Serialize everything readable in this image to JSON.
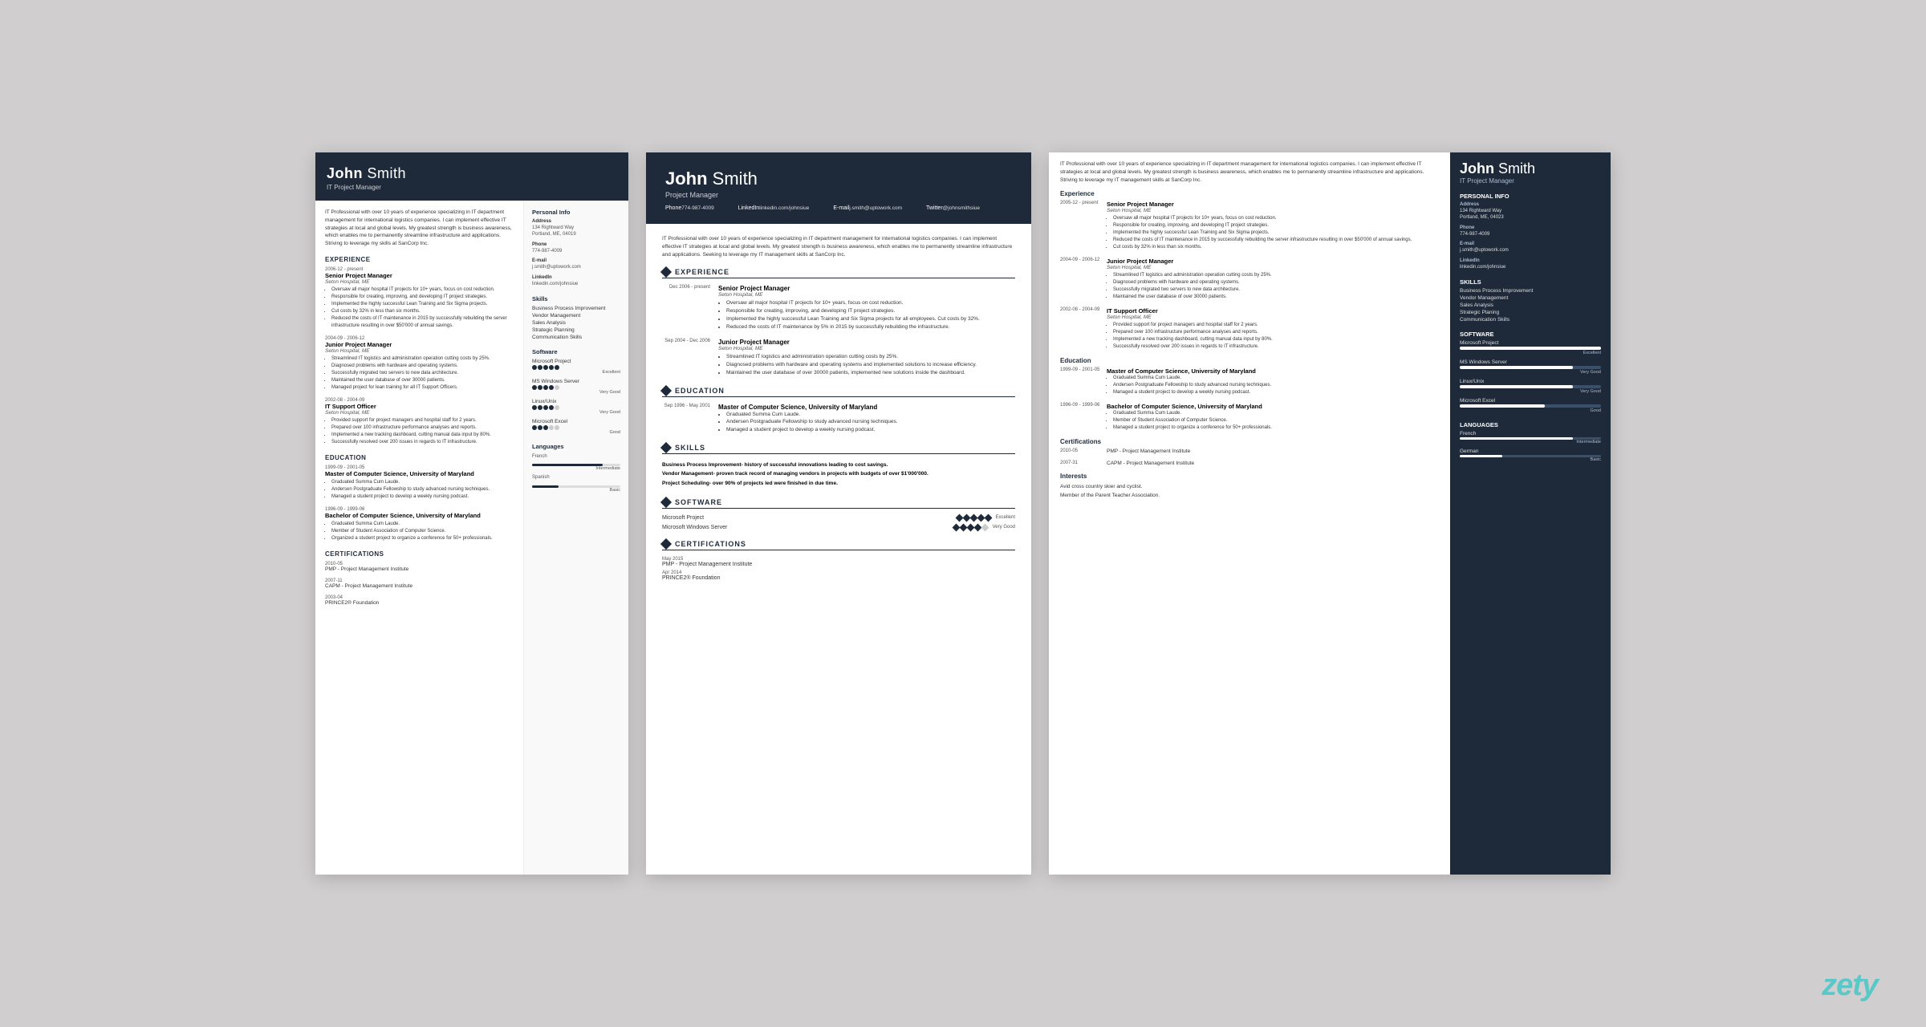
{
  "resume1": {
    "name_bold": "John",
    "name_light": " Smith",
    "title": "IT Project Manager",
    "summary": "IT Professional with over 10 years of experience specializing in IT department management for international logistics companies. I can implement effective IT strategies at local and global levels. My greatest strength is business awareness, which enables me to permanently streamline infrastructure and applications. Striving to leverage my skills at SanCorp Inc.",
    "experience_title": "Experience",
    "experience": [
      {
        "dates": "2006-12 - present",
        "title": "Senior Project Manager",
        "company": "Seton Hospital, ME",
        "bullets": [
          "Oversaw all major hospital IT projects for 10+ years, focus on cost reduction.",
          "Responsible for creating, improving, and developing IT project strategies.",
          "Implemented the highly successful Lean Training and Six Sigma projects.",
          "Cut costs by 32% in less than six months.",
          "Reduced the costs of IT maintenance in 2015 by successfully rebuilding the server infrastructure resulting in over $50'000 of annual savings."
        ]
      },
      {
        "dates": "2004-09 - 2006-12",
        "title": "Junior Project Manager",
        "company": "Seton Hospital, ME",
        "bullets": [
          "Streamlined IT logistics and administration operation cutting costs by 25%.",
          "Diagnosed problems with hardware and operating systems.",
          "Successfully migrated two servers to new data architecture.",
          "Maintained the user database of over 30000 patients.",
          "Managed project for lean training for all IT Support Officers."
        ]
      },
      {
        "dates": "2002-08 - 2004-09",
        "title": "IT Support Officer",
        "company": "Seton Hospital, ME",
        "bullets": [
          "Provided support for project managers and hospital staff for 2 years.",
          "Prepared over 100 infrastructure performance analyses and reports.",
          "Implemented a new tracking dashboard, cutting manual data input by 80%.",
          "Successfully resolved over 200 issues in regards to IT infrastructure."
        ]
      }
    ],
    "education_title": "Education",
    "education": [
      {
        "dates": "1999-09 - 2001-05",
        "title": "Master of Computer Science, University of Maryland",
        "bullets": [
          "Graduated Summa Cum Laude.",
          "Andersen Postgraduate Fellowship to study advanced nursing techniques.",
          "Managed a student project to develop a weekly nursing podcast."
        ]
      },
      {
        "dates": "1996-09 - 1999-06",
        "title": "Bachelor of Computer Science, University of Maryland",
        "bullets": [
          "Graduated Summa Cum Laude.",
          "Member of Student Association of Computer Science.",
          "Organized a student project to organize a conference for 50+ professionals."
        ]
      }
    ],
    "certifications_title": "Certifications",
    "certifications": [
      {
        "dates": "2010-05",
        "name": "PMP - Project Management Institute"
      },
      {
        "dates": "2007-11",
        "name": "CAPM - Project Management Institute"
      },
      {
        "dates": "2003-04",
        "name": "PRINCE2® Foundation"
      }
    ],
    "sidebar": {
      "personal_info": "Personal Info",
      "address_label": "Address",
      "address": "134 Rightward Way\nPortland, ME, 04019",
      "phone_label": "Phone",
      "phone": "774-987-4009",
      "email_label": "E-mail",
      "email": "j.smith@uptowork.com",
      "linkedin_label": "LinkedIn",
      "linkedin": "linkedin.com/johnsiue",
      "skills_title": "Skills",
      "skills": [
        "Business Process Improvement",
        "Vendor Management",
        "Sales Analysis",
        "Strategic Planning",
        "Communication Skills"
      ],
      "software_title": "Software",
      "software": [
        {
          "name": "Microsoft Project",
          "filled": 5,
          "total": 5,
          "label": "Excellent"
        },
        {
          "name": "MS Windows Server",
          "filled": 4,
          "total": 5,
          "label": "Very Good"
        },
        {
          "name": "Linux/Unix",
          "filled": 4,
          "total": 5,
          "label": "Very Good"
        },
        {
          "name": "Microsoft Excel",
          "filled": 3,
          "total": 5,
          "label": "Good"
        }
      ],
      "languages_title": "Languages",
      "languages": [
        {
          "name": "French",
          "level": 80,
          "label": "Intermediate"
        },
        {
          "name": "Spanish",
          "level": 30,
          "label": "Basic"
        }
      ]
    }
  },
  "resume2": {
    "name_bold": "John",
    "name_light": " Smith",
    "title": "Project Manager",
    "contact": [
      {
        "label": "Phone",
        "value": "774-987-4009"
      },
      {
        "label": "LinkedIn",
        "value": "linkedin.com/johnsiue"
      },
      {
        "label": "E-mail",
        "value": "j.smith@uptowork.com"
      },
      {
        "label": "Twitter",
        "value": "@johnsmithsiue"
      }
    ],
    "summary": "IT Professional with over 10 years of experience specializing in IT department management for international logistics companies. I can implement effective IT strategies at local and global levels. My greatest strength is business awareness, which enables me to permanently streamline infrastructure and applications. Seeking to leverage my IT management skills at SanCorp Inc.",
    "experience": [
      {
        "dates": "Dec 2006 - present",
        "title": "Senior Project Manager",
        "company": "Seton Hospital, ME",
        "bullets": [
          "Oversaw all major hospital IT projects for 10+ years, focus on cost reduction.",
          "Responsible for creating, improving, and developing IT project strategies.",
          "Implemented the highly successful Lean Training and Six Sigma projects for all employees. Cut costs by 32%.",
          "Reduced the costs of IT maintenance by 5% in 2015 by successfully rebuilding the infrastructure."
        ]
      },
      {
        "dates": "Sep 2004 - Dec 2006",
        "title": "Junior Project Manager",
        "company": "Seton Hospital, ME",
        "bullets": [
          "Streamlined IT logistics and administration operation cutting costs by 25%.",
          "Diagnosed problems with hardware and operating systems and implemented solutions to increase efficiency.",
          "Maintained the user database of over 30000 patients, implemented new solutions inside the dashboard."
        ]
      }
    ],
    "education": [
      {
        "dates": "Sep 1996 - May 2001",
        "title": "Master of Computer Science, University of Maryland",
        "bullets": [
          "Graduated Summa Cum Laude.",
          "Andersen Postgraduate Fellowship to study advanced nursing techniques.",
          "Managed a student project to develop a weekly nursing podcast."
        ]
      }
    ],
    "skills": [
      {
        "name": "Business Process Improvement",
        "desc": "- history of successful innovations leading to cost savings."
      },
      {
        "name": "Vendor Management",
        "desc": "- proven track record of managing vendors in projects with budgets of over $1'000'000."
      },
      {
        "name": "Project Scheduling",
        "desc": "- over 90% of projects led were finished in due time."
      }
    ],
    "software": [
      {
        "name": "Microsoft Project",
        "filled": 5,
        "total": 5,
        "label": "Excellent"
      },
      {
        "name": "Microsoft Windows Server",
        "filled": 4,
        "total": 5,
        "label": "Very Good"
      }
    ],
    "certifications": [
      {
        "dates": "May 2015",
        "name": "PMP - Project Management Institute"
      },
      {
        "dates": "Apr 2014",
        "name": "PRINCE2® Foundation"
      }
    ]
  },
  "resume3": {
    "main": {
      "summary": "IT Professional with over 10 years of experience specializing in IT department management for international logistics companies. I can implement effective IT strategies at local and global levels. My greatest strength is business awareness, which enables me to permanently streamline infrastructure and applications. Striving to leverage my IT management skills at SanCorp Inc.",
      "experience": [
        {
          "dates": "2005-12 - present",
          "title": "Senior Project Manager",
          "company": "Seton Hospital, ME",
          "bullets": [
            "Oversaw all major hospital IT projects for 10+ years, focus on cost reduction.",
            "Responsible for creating, improving, and developing IT project strategies.",
            "Implemented the highly successful Lean Training and Six Sigma projects.",
            "Reduced the costs of IT maintenance in 2015 by successfully rebuilding the server infrastructure resulting in over $50'000 of annual savings.",
            "Cut costs by 32% in less than six months."
          ]
        },
        {
          "dates": "2004-09 - 2006-12",
          "title": "Junior Project Manager",
          "company": "Seton Hospital, ME",
          "bullets": [
            "Streamlined IT logistics and administration operation cutting costs by 25%.",
            "Diagnosed problems with hardware and operating systems.",
            "Successfully migrated two servers to new data architecture.",
            "Maintained the user database of over 30000 patients."
          ]
        },
        {
          "dates": "2002-08 - 2004-09",
          "title": "IT Support Officer",
          "company": "Seton Hospital, ME",
          "bullets": [
            "Provided support for project managers and hospital staff for 2 years.",
            "Prepared over 100 infrastructure performance analyses and reports.",
            "Implemented a new tracking dashboard, cutting manual data input by 80%.",
            "Successfully resolved over 200 issues in regards to IT infrastructure."
          ]
        }
      ],
      "education": [
        {
          "dates": "1999-09 - 2001-05",
          "title": "Master of Computer Science, University of Maryland",
          "bullets": [
            "Graduated Summa Cum Laude.",
            "Andersen Postgraduate Fellowship to study advanced nursing techniques.",
            "Managed a student project to develop a weekly nursing podcast."
          ]
        },
        {
          "dates": "1996-09 - 1999-06",
          "title": "Bachelor of Computer Science, University of Maryland",
          "bullets": [
            "Graduated Summa Cum Laude.",
            "Member of Student Association of Computer Science.",
            "Managed a student project to organize a conference for 50+ professionals."
          ]
        }
      ],
      "certifications": [
        {
          "dates": "2010-05",
          "name": "PMP - Project Management Institute"
        },
        {
          "dates": "2007-31",
          "name": "CAPM - Project Management Institute"
        }
      ],
      "interests": "Avid cross country skier and cyclist.\nMember of the Parent Teacher Association."
    },
    "sidebar": {
      "name_bold": "John",
      "name_light": " Smith",
      "title": "IT Project Manager",
      "address_label": "Address",
      "address": "134 Rightward Way\nPortland, ME, 04023",
      "phone_label": "Phone",
      "phone": "774-987-4009",
      "email_label": "E-mail",
      "email": "j.smith@uptowork.com",
      "linkedin_label": "LinkedIn",
      "linkedin": "linkedin.com/johnsiue",
      "skills_title": "Skills",
      "skills": [
        "Business Process Improvement",
        "Vendor Management",
        "Sales Analysis",
        "Strategic Planing",
        "Communication Skills"
      ],
      "software_title": "Software",
      "software": [
        {
          "name": "Microsoft Project",
          "pct": 100,
          "label": "Excellent"
        },
        {
          "name": "MS Windows Server",
          "pct": 80,
          "label": "Very Good"
        },
        {
          "name": "Linux/Unix",
          "pct": 80,
          "label": "Very Good"
        },
        {
          "name": "Microsoft Excel",
          "pct": 60,
          "label": "Good"
        }
      ],
      "languages_title": "Languages",
      "languages": [
        {
          "name": "French",
          "pct": 80,
          "label": "Intermediate"
        },
        {
          "name": "German",
          "pct": 30,
          "label": "Basic"
        }
      ]
    }
  },
  "watermark": "zety"
}
